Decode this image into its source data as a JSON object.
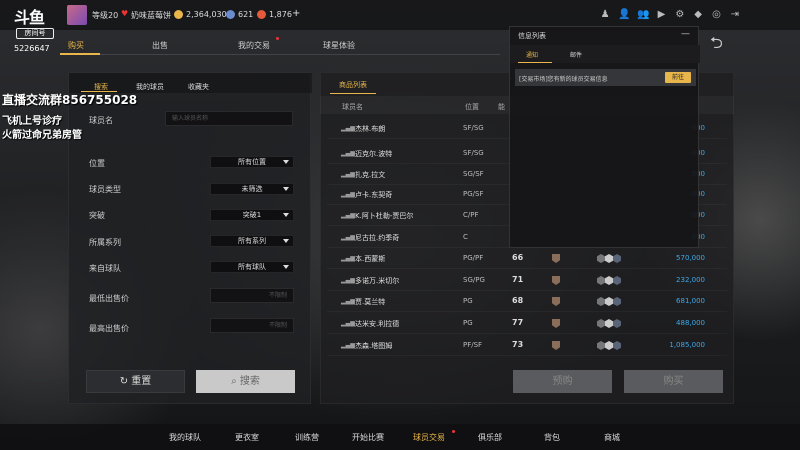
{
  "streamer": {
    "logo_text": "斗鱼",
    "room_label": "房间号",
    "room_id": "5226647"
  },
  "topbar": {
    "level": "等级20",
    "nickname": "奶味蓝莓饼",
    "gold": "2,364,030",
    "diamond": "621",
    "tickets": "1,876",
    "plus": "+"
  },
  "nav": {
    "tabs": [
      {
        "label": "购买",
        "active": true
      },
      {
        "label": "出售"
      },
      {
        "label": "我的交易"
      },
      {
        "label": "球星体验"
      }
    ]
  },
  "overlay": {
    "line1": "直播交流群856755028",
    "line2": "飞机上号诊疗",
    "line3": "火箭过命兄弟房管"
  },
  "filter": {
    "tabs": [
      "搜索",
      "我的球员",
      "收藏夹"
    ],
    "player_name_label": "球员名",
    "player_name_placeholder": "输入球员名称",
    "fields": [
      {
        "label": "位置",
        "value": "所有位置"
      },
      {
        "label": "球员类型",
        "value": "未筛选"
      },
      {
        "label": "突破",
        "value": "突破1"
      },
      {
        "label": "所属系列",
        "value": "所有系列"
      },
      {
        "label": "来自球队",
        "value": "所有球队"
      }
    ],
    "min_price_label": "最低出售价",
    "min_price_placeholder": "不限制",
    "max_price_label": "最高出售价",
    "max_price_placeholder": "不限制",
    "reset_label": "重置",
    "search_label": "搜索"
  },
  "list": {
    "tab_label": "商品列表",
    "headers": {
      "name": "球员名",
      "position": "位置",
      "ovr": "能"
    },
    "rows": [
      {
        "name": "杰林.布朗",
        "pos": "SF/SG",
        "ovr": "",
        "price": "000"
      },
      {
        "name": "迈克尔.波特",
        "pos": "SF/SG",
        "ovr": "",
        "price": "000"
      },
      {
        "name": "扎克.拉文",
        "pos": "SG/SF",
        "ovr": "",
        "price": "000"
      },
      {
        "name": "卢卡.东契奇",
        "pos": "PG/SF",
        "ovr": "",
        "price": "000"
      },
      {
        "name": "K.阿卜杜勒-贾巴尔",
        "pos": "C/PF",
        "ovr": "",
        "price": "000"
      },
      {
        "name": "尼古拉.约季奇",
        "pos": "C",
        "ovr": "",
        "price": "000"
      },
      {
        "name": "本.西蒙斯",
        "pos": "PG/PF",
        "ovr": "66",
        "price": "570,000"
      },
      {
        "name": "多诺万.米切尔",
        "pos": "SG/PG",
        "ovr": "71",
        "price": "232,000"
      },
      {
        "name": "贾.莫兰特",
        "pos": "PG",
        "ovr": "68",
        "price": "681,000"
      },
      {
        "name": "达米安.利拉德",
        "pos": "PG",
        "ovr": "77",
        "price": "488,000"
      },
      {
        "name": "杰森.塔图姆",
        "pos": "PF/SF",
        "ovr": "73",
        "price": "1,085,000"
      }
    ],
    "preorder_label": "预购",
    "buy_label": "购买"
  },
  "popup": {
    "title": "信息列表",
    "close": "—",
    "tabs": [
      "通知",
      "邮件"
    ],
    "message": "[交易市场]您有新的球员交易信息",
    "goto_label": "前往"
  },
  "bottom_nav": [
    {
      "label": "我的球队"
    },
    {
      "label": "更衣室"
    },
    {
      "label": "训练营"
    },
    {
      "label": "开始比赛"
    },
    {
      "label": "球员交易",
      "active": true
    },
    {
      "label": "俱乐部"
    },
    {
      "label": "背包"
    },
    {
      "label": "商城"
    }
  ],
  "colors": {
    "accent": "#e8b64a",
    "price": "#3ea8e6"
  }
}
